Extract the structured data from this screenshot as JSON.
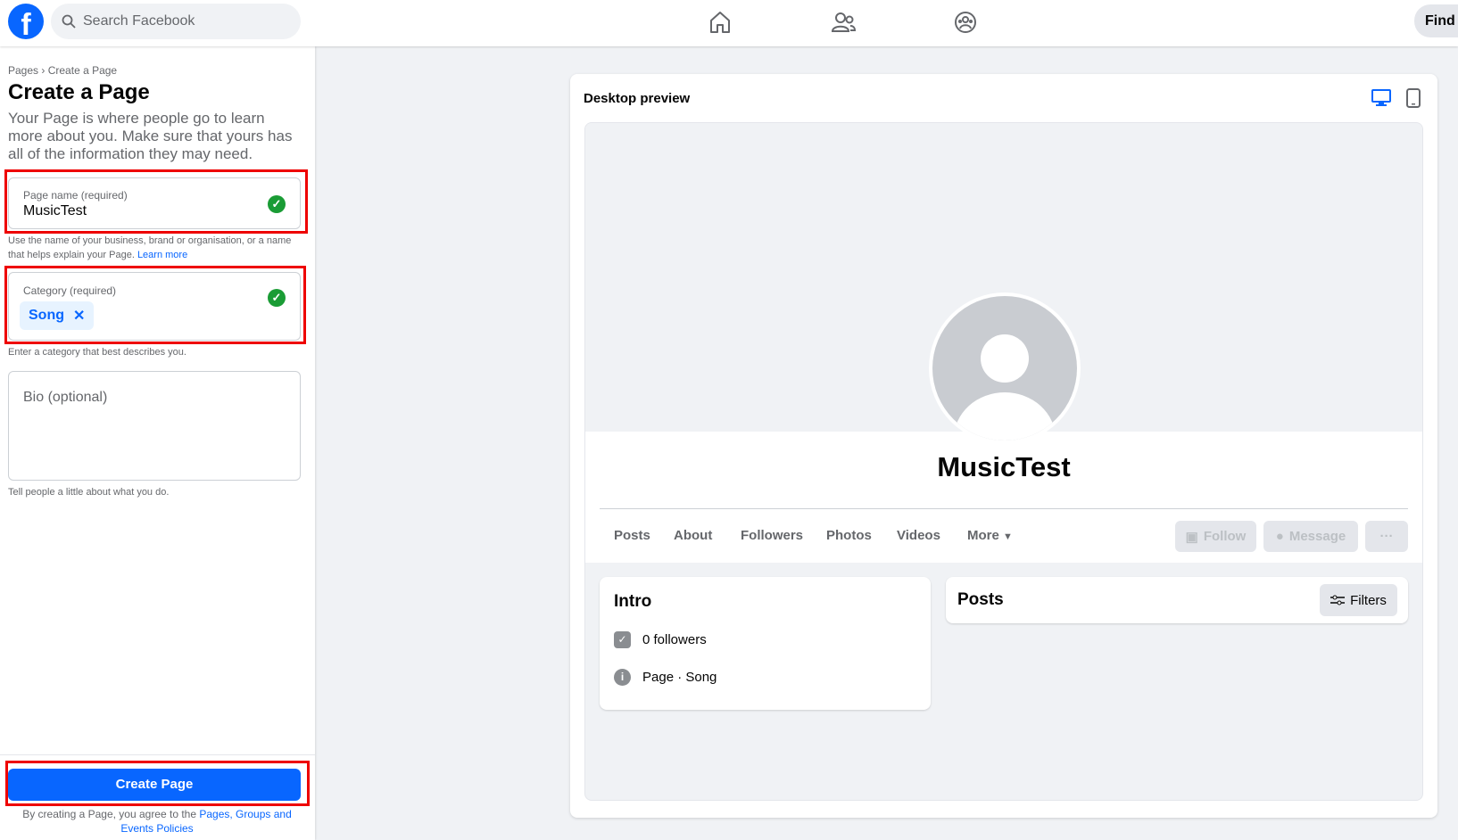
{
  "topbar": {
    "search_placeholder": "Search Facebook",
    "find_label": "Find f"
  },
  "left": {
    "breadcrumb": [
      "Pages",
      "›",
      "Create a Page"
    ],
    "title": "Create a Page",
    "description": "Your Page is where people go to learn more about you. Make sure that yours has all of the information they may need.",
    "page_name": {
      "label": "Page name (required)",
      "value": "MusicTest",
      "help": "Use the name of your business, brand or organisation, or a name that helps explain your Page.",
      "learn_more": "Learn more"
    },
    "category": {
      "label": "Category (required)",
      "chip": "Song",
      "chip_remove": "✕",
      "help": "Enter a category that best describes you."
    },
    "bio": {
      "placeholder": "Bio (optional)",
      "help": "Tell people a little about what you do."
    },
    "create_button": "Create Page",
    "terms_prefix": "By creating a Page, you agree to the ",
    "terms_link": "Pages, Groups and Events Policies"
  },
  "preview": {
    "title": "Desktop preview",
    "page_name": "MusicTest",
    "tabs": [
      "Posts",
      "About",
      "Followers",
      "Photos",
      "Videos",
      "More"
    ],
    "follow": "Follow",
    "message": "Message",
    "more_dots": "···",
    "intro": {
      "title": "Intro",
      "followers": "0 followers",
      "page_type": "Page · Song"
    },
    "posts": {
      "title": "Posts",
      "filters": "Filters"
    }
  },
  "colors": {
    "accent": "#0866ff",
    "highlight": "#e00000",
    "check": "#1a9c35"
  }
}
